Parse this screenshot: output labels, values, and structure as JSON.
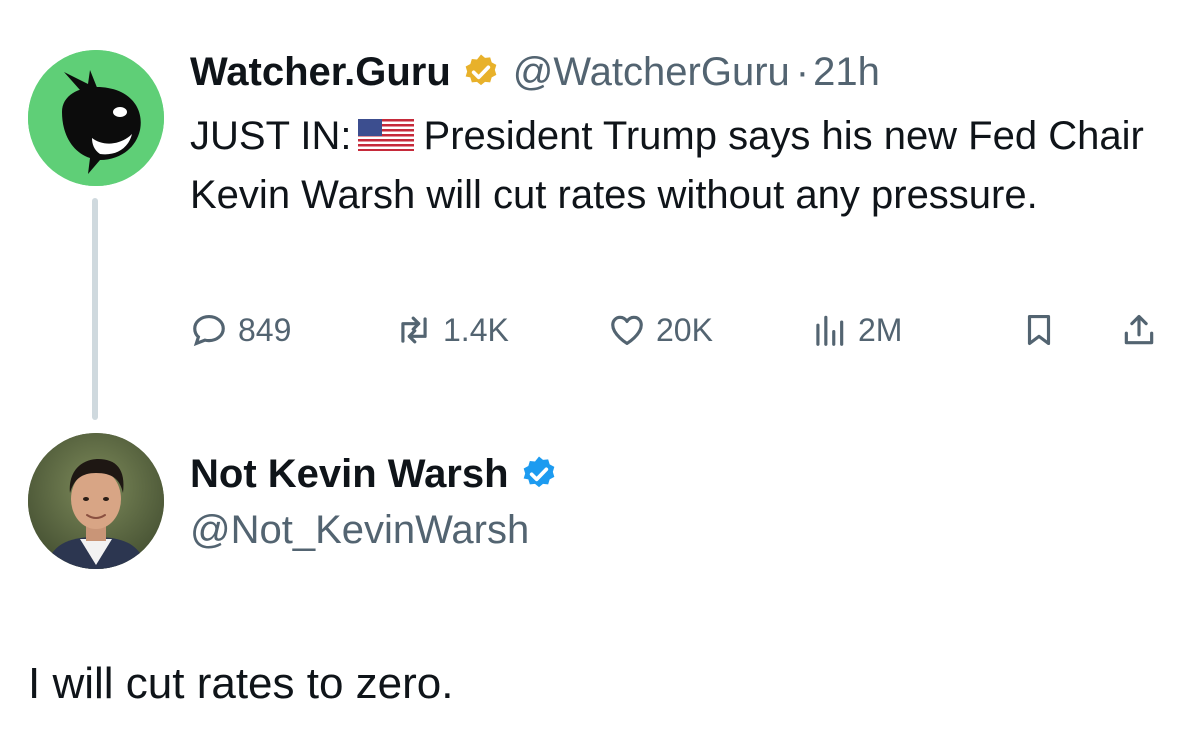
{
  "original_tweet": {
    "author": {
      "display_name": "Watcher.Guru",
      "handle": "@WatcherGuru",
      "verified_badge_color": "#e8b12a",
      "avatar_icon": "whale-logo-icon",
      "avatar_bg": "#5fcf77"
    },
    "separator": "·",
    "time": "21h",
    "text_prefix": "JUST IN:",
    "flag_icon": "us-flag-icon",
    "text_body": "President Trump says his new Fed Chair Kevin Warsh will cut rates without any pressure.",
    "stats": {
      "replies": "849",
      "retweets": "1.4K",
      "likes": "20K",
      "views": "2M"
    }
  },
  "reply": {
    "author": {
      "display_name": "Not Kevin Warsh",
      "handle": "@Not_KevinWarsh",
      "verified_badge_color": "#1d9bf0",
      "avatar_icon": "profile-photo"
    },
    "text": "I will cut rates to zero."
  },
  "colors": {
    "text": "#0f1419",
    "muted": "#536471",
    "thread_line": "#cfd9de"
  }
}
